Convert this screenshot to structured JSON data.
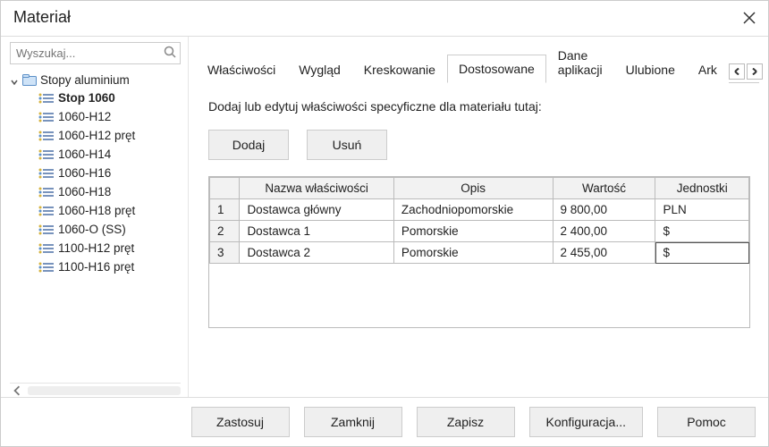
{
  "window": {
    "title": "Materiał"
  },
  "search": {
    "placeholder": "Wyszukaj..."
  },
  "tree": {
    "root": {
      "label": "Stopy aluminium"
    },
    "items": [
      {
        "label": "Stop 1060",
        "selected": true
      },
      {
        "label": "1060-H12"
      },
      {
        "label": "1060-H12 pręt"
      },
      {
        "label": "1060-H14"
      },
      {
        "label": "1060-H16"
      },
      {
        "label": "1060-H18"
      },
      {
        "label": "1060-H18 pręt"
      },
      {
        "label": "1060-O (SS)"
      },
      {
        "label": "1100-H12 pręt"
      },
      {
        "label": "1100-H16 pręt"
      }
    ]
  },
  "tabs": {
    "items": [
      {
        "label": "Właściwości"
      },
      {
        "label": "Wygląd"
      },
      {
        "label": "Kreskowanie"
      },
      {
        "label": "Dostosowane",
        "active": true
      },
      {
        "label": "Dane aplikacji"
      },
      {
        "label": "Ulubione"
      },
      {
        "label": "Ark"
      }
    ]
  },
  "panel": {
    "instruction": "Dodaj lub edytuj właściwości specyficzne dla materiału tutaj:",
    "add_label": "Dodaj",
    "delete_label": "Usuń",
    "headers": {
      "name": "Nazwa właściwości",
      "desc": "Opis",
      "value": "Wartość",
      "unit": "Jednostki"
    },
    "rows": [
      {
        "n": "1",
        "name": "Dostawca główny",
        "desc": "Zachodniopomorskie",
        "value": "9 800,00",
        "unit": "PLN"
      },
      {
        "n": "2",
        "name": "Dostawca 1",
        "desc": "Pomorskie",
        "value": "2 400,00",
        "unit": "$"
      },
      {
        "n": "3",
        "name": "Dostawca 2",
        "desc": "Pomorskie",
        "value": "2 455,00",
        "unit": "$",
        "editing_unit": true
      }
    ]
  },
  "footer": {
    "apply": "Zastosuj",
    "close": "Zamknij",
    "save": "Zapisz",
    "config": "Konfiguracja...",
    "help": "Pomoc"
  }
}
